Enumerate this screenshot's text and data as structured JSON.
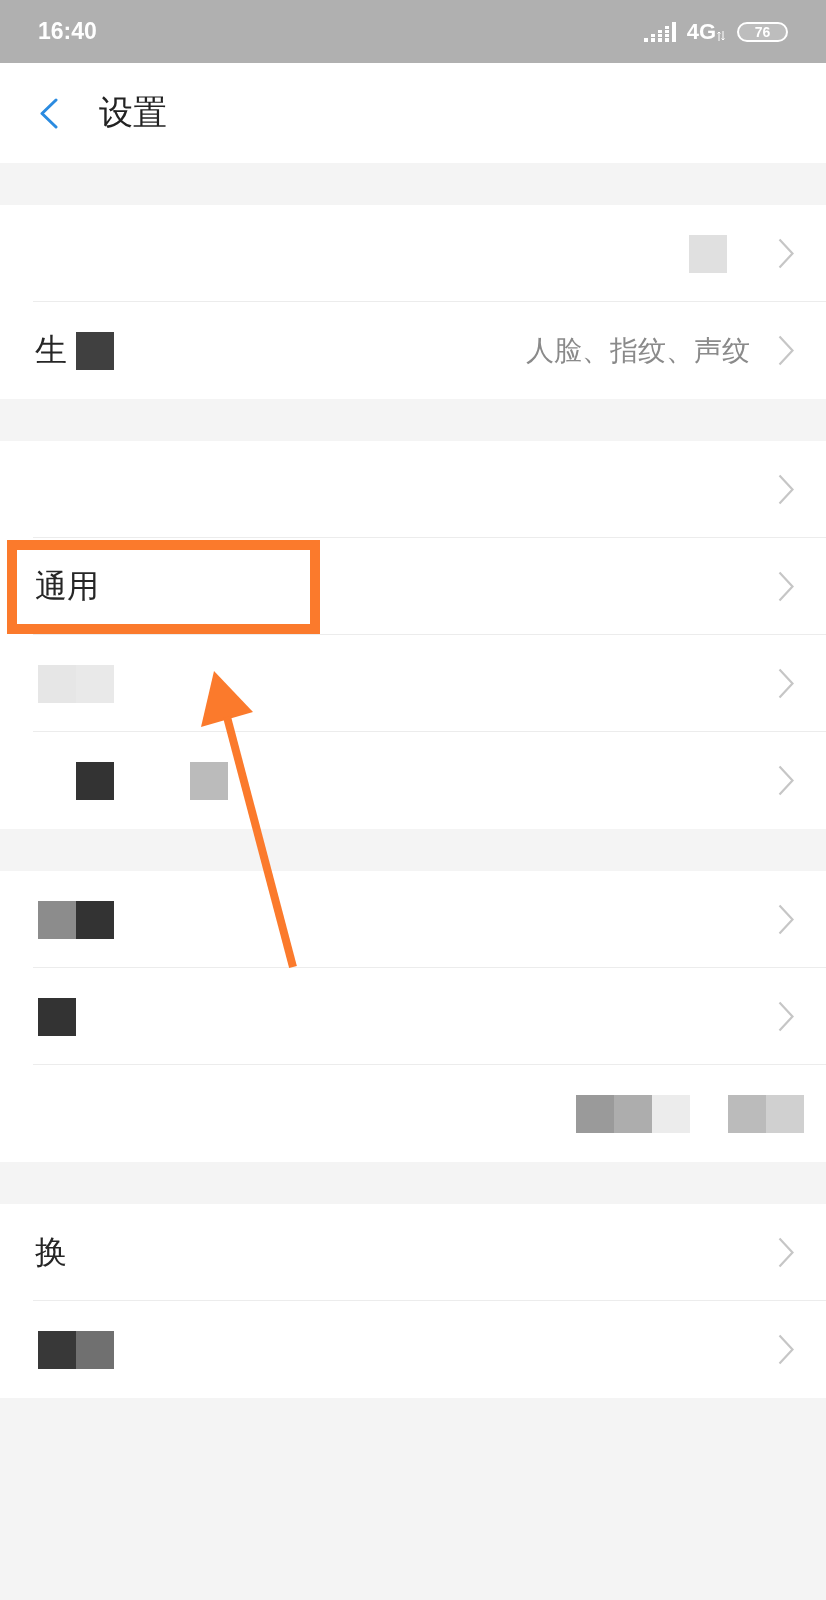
{
  "status_bar": {
    "time": "16:40",
    "network": "4G",
    "battery": "76"
  },
  "header": {
    "title": "设置"
  },
  "groups": [
    {
      "rows": [
        {
          "label_redacted": false,
          "value_redacted": true,
          "highlighted": false,
          "chevron": true
        },
        {
          "label": "生",
          "label_redacted": true,
          "value": "人脸、指纹、声纹",
          "value_redacted": false,
          "highlighted": false,
          "chevron": true
        }
      ]
    },
    {
      "rows": [
        {
          "label_redacted": false,
          "value_redacted": false,
          "highlighted": false,
          "chevron": true
        },
        {
          "label": "通用",
          "label_redacted": false,
          "value_redacted": false,
          "highlighted": true,
          "chevron": true
        },
        {
          "label_redacted": true,
          "value_redacted": false,
          "highlighted": false,
          "chevron": true
        },
        {
          "label_redacted": true,
          "value_redacted": false,
          "highlighted": false,
          "chevron": true
        }
      ]
    },
    {
      "rows": [
        {
          "label_redacted": true,
          "value_redacted": false,
          "highlighted": false,
          "chevron": true
        },
        {
          "label_redacted": true,
          "value_redacted": false,
          "highlighted": false,
          "chevron": true
        },
        {
          "label_redacted": false,
          "value_redacted": true,
          "highlighted": false,
          "chevron": false
        }
      ]
    },
    {
      "rows": [
        {
          "label": "换",
          "label_redacted": false,
          "value_redacted": false,
          "highlighted": false,
          "chevron": true
        },
        {
          "label_redacted": true,
          "value_redacted": false,
          "highlighted": false,
          "chevron": true
        }
      ]
    }
  ]
}
